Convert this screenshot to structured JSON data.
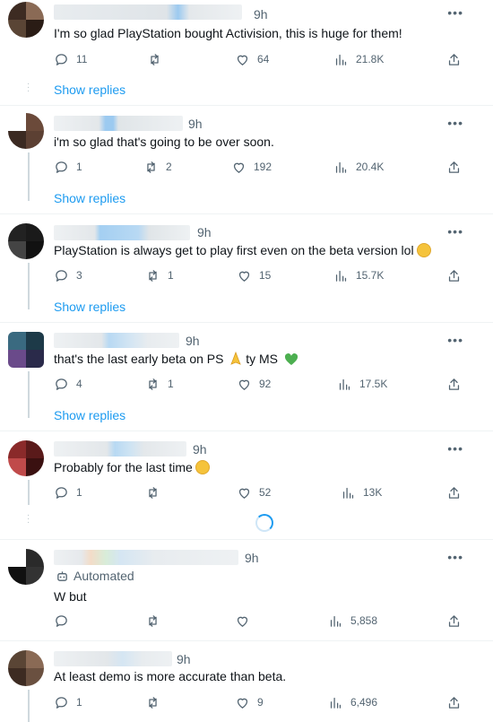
{
  "replies": [
    {
      "time": "9h",
      "text": "I'm so glad PlayStation bought Activision, this is huge for them!",
      "emoji": "",
      "replies_count": "11",
      "reposts": "",
      "likes": "64",
      "views": "21.8K",
      "show_replies": "Show replies",
      "avatar_colors": [
        "#3d2b22",
        "#8a6a55",
        "#5a4535",
        "#2a1c15"
      ]
    },
    {
      "time": "9h",
      "text": "i'm so glad that's going to be over soon.",
      "emoji": "",
      "replies_count": "1",
      "reposts": "2",
      "likes": "192",
      "views": "20.4K",
      "show_replies": "Show replies",
      "avatar_colors": [
        "#ffffff",
        "#6b4a3a",
        "#3b2a22",
        "#5c4033"
      ]
    },
    {
      "time": "9h",
      "text": "PlayStation is always get to play first even on the beta version lol",
      "emoji": "laugh",
      "replies_count": "3",
      "reposts": "1",
      "likes": "15",
      "views": "15.7K",
      "show_replies": "Show replies",
      "avatar_colors": [
        "#222222",
        "#1a1a1a",
        "#444444",
        "#111111"
      ]
    },
    {
      "time": "9h",
      "text": "that's the last early beta on PS",
      "text2": "ty MS",
      "emoji": "pray",
      "emoji2": "heart",
      "replies_count": "4",
      "reposts": "1",
      "likes": "92",
      "views": "17.5K",
      "show_replies": "Show replies",
      "avatar_colors": [
        "#3a6a80",
        "#1d3a48",
        "#6a4a8a",
        "#2a2a4a"
      ]
    },
    {
      "time": "9h",
      "text": "Probably for the last time",
      "emoji": "smirk",
      "replies_count": "1",
      "reposts": "",
      "likes": "52",
      "views": "13K",
      "show_replies": "",
      "avatar_colors": [
        "#8a2a2a",
        "#5a1a1a",
        "#c04a4a",
        "#3a1010"
      ]
    },
    {
      "time": "9h",
      "automated": "Automated",
      "text": "W but",
      "emoji": "",
      "replies_count": "",
      "reposts": "",
      "likes": "",
      "views": "5,858",
      "show_replies": "",
      "avatar_colors": [
        "#ffffff",
        "#2a2a2a",
        "#111111",
        "#333333"
      ]
    },
    {
      "time": "9h",
      "text": "At least demo is more accurate than beta.",
      "emoji": "",
      "replies_count": "1",
      "reposts": "",
      "likes": "9",
      "views": "6,496",
      "show_replies": "",
      "avatar_colors": [
        "#5a4535",
        "#8a6a55",
        "#3d2b22",
        "#6a5040"
      ]
    }
  ],
  "icons": {
    "reply": "reply-icon",
    "repost": "repost-icon",
    "like": "like-icon",
    "views": "views-icon",
    "share": "share-icon",
    "more": "more-icon",
    "automated": "bot-icon"
  },
  "colors": {
    "accent": "#1d9bf0",
    "muted": "#536471",
    "text": "#0f1419",
    "divider": "#eff3f4"
  }
}
